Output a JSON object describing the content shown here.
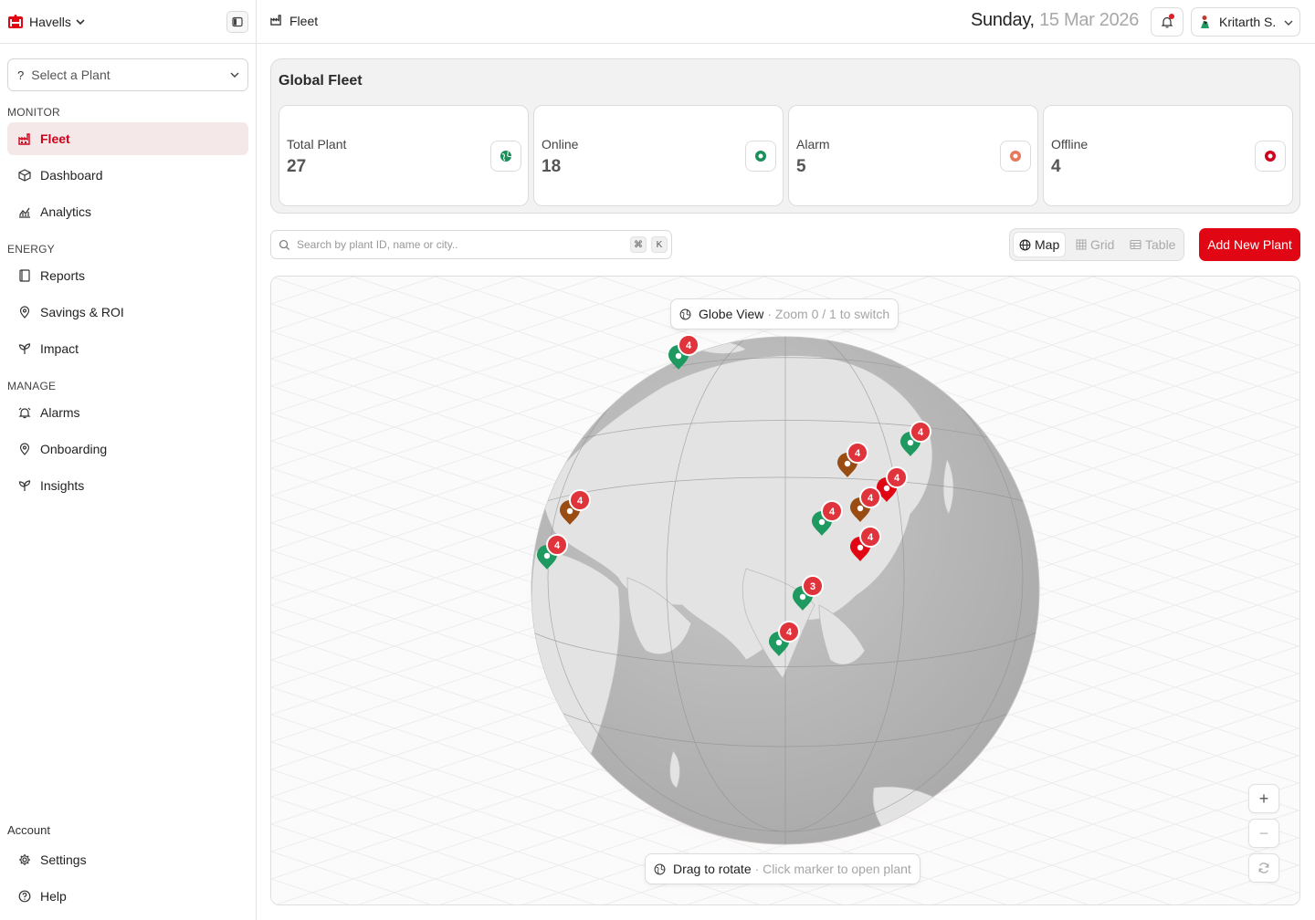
{
  "brand": {
    "name": "Havells",
    "color": "#e10613"
  },
  "sidebar": {
    "plant_select": {
      "icon": "?",
      "label": "Select a Plant"
    },
    "sections": {
      "monitor": "MONITOR",
      "energy": "ENERGY",
      "manage": "MANAGE",
      "account": "Account"
    },
    "items": {
      "fleet": {
        "label": "Fleet",
        "icon": "factory-icon"
      },
      "dashboard": {
        "label": "Dashboard",
        "icon": "cube-icon"
      },
      "analytics": {
        "label": "Analytics",
        "icon": "chart-icon"
      },
      "reports": {
        "label": "Reports",
        "icon": "book-icon"
      },
      "savings": {
        "label": "Savings & ROI",
        "icon": "pin-icon"
      },
      "impact": {
        "label": "Impact",
        "icon": "sprout-icon"
      },
      "alarms": {
        "label": "Alarms",
        "icon": "alarm-icon"
      },
      "onboarding": {
        "label": "Onboarding",
        "icon": "pin-icon"
      },
      "insights": {
        "label": "Insights",
        "icon": "sprout-icon"
      },
      "settings": {
        "label": "Settings",
        "icon": "gear-icon"
      },
      "help": {
        "label": "Help",
        "icon": "help-icon"
      }
    },
    "active": "fleet"
  },
  "header": {
    "breadcrumb": "Fleet",
    "date_day": "Sunday,",
    "date_rest": "15 Mar 2026",
    "user_name": "Kritarth S."
  },
  "fleet": {
    "title": "Global Fleet",
    "stats": [
      {
        "label": "Total Plant",
        "value": "27",
        "icon": "globe-icon",
        "color": "#1a8f5a"
      },
      {
        "label": "Online",
        "value": "18",
        "icon": "status-online-icon",
        "color": "#1a8f5a"
      },
      {
        "label": "Alarm",
        "value": "5",
        "icon": "status-alarm-icon",
        "color": "#e8765a"
      },
      {
        "label": "Offline",
        "value": "4",
        "icon": "status-offline-icon",
        "color": "#d0021b"
      }
    ]
  },
  "toolbar": {
    "search_placeholder": "Search by plant ID, name or city..",
    "kbd_cmd": "⌘",
    "kbd_k": "K",
    "views": {
      "map": "Map",
      "grid": "Grid",
      "table": "Table"
    },
    "active_view": "map",
    "add_button": "Add New Plant"
  },
  "map": {
    "globe_label": "Globe View",
    "globe_hint": "· Zoom 0 / 1 to switch",
    "rotate_label": "Drag to rotate",
    "rotate_hint": "· Click marker to open plant",
    "zoom_in": "+",
    "zoom_out": "−",
    "reset_icon": "refresh-icon",
    "status_colors": {
      "online": "#1e9a60",
      "alarm": "#9a4d12",
      "offline": "#e10613"
    },
    "markers": [
      {
        "count": "4",
        "status": "online"
      },
      {
        "count": "4",
        "status": "online"
      },
      {
        "count": "4",
        "status": "alarm"
      },
      {
        "count": "4",
        "status": "offline"
      },
      {
        "count": "4",
        "status": "alarm"
      },
      {
        "count": "4",
        "status": "online"
      },
      {
        "count": "4",
        "status": "offline"
      },
      {
        "count": "4",
        "status": "alarm"
      },
      {
        "count": "4",
        "status": "online"
      },
      {
        "count": "3",
        "status": "online"
      },
      {
        "count": "4",
        "status": "online"
      }
    ]
  }
}
